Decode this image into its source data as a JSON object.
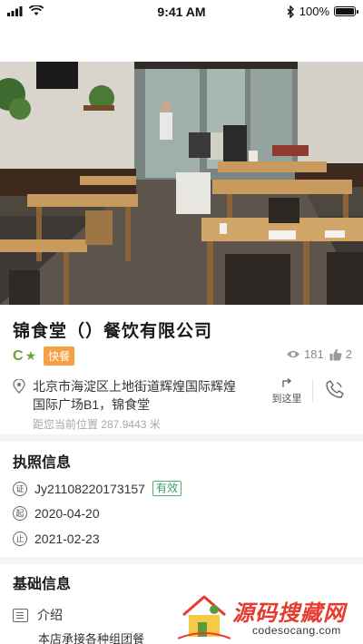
{
  "status_bar": {
    "time": "9:41 AM",
    "battery": "100%"
  },
  "store": {
    "name": "锦食堂（）餐饮有限公司",
    "grade": "C",
    "category_tag": "快餐",
    "views": "181",
    "likes": "2",
    "address": "北京市海淀区上地街道辉煌国际辉煌国际广场B1，锦食堂",
    "distance": "距您当前位置 287.9443 米",
    "navigate_label": "到这里"
  },
  "license": {
    "section_title": "执照信息",
    "number": "Jy21108220173157",
    "status": "有效",
    "start_date": "2020-04-20",
    "end_date": "2021-02-23",
    "start_icon_label": "起",
    "end_icon_label": "止",
    "cert_icon_label": "证"
  },
  "basic": {
    "section_title": "基础信息",
    "intro_label": "介绍",
    "intro_text": "本店承接各种组团餐"
  },
  "watermark": {
    "title": "源码搜藏网",
    "subtitle": "codesocang.com"
  },
  "colors": {
    "grade_green": "#6aa531",
    "tag_orange": "#f5a043",
    "valid_green": "#3b9e66",
    "watermark_red": "#e63b2e"
  }
}
